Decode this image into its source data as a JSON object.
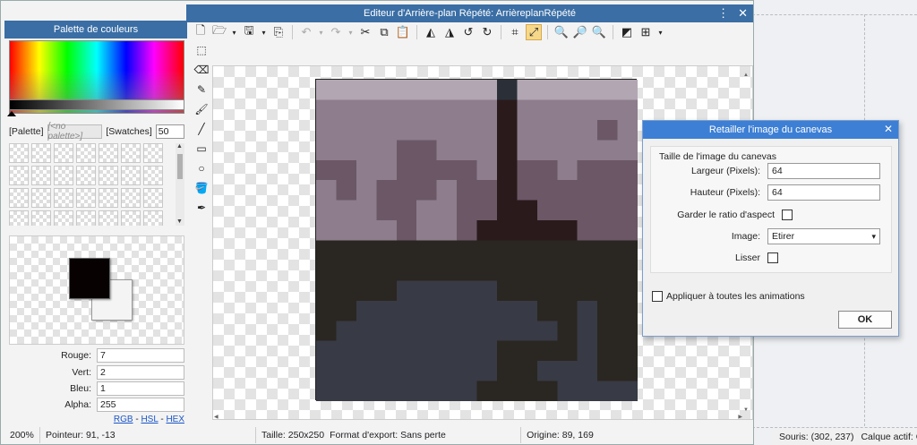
{
  "window": {
    "title": "Editeur d'Arrière-plan Répété: ArrièreplanRépété",
    "menu_icon": "⋮",
    "close_icon": "✕"
  },
  "palette": {
    "title": "Palette de couleurs",
    "palette_label": "[Palette]",
    "no_palette": "[<no palette>]",
    "swatches_label": "[Swatches]",
    "swatch_count": "50",
    "primary_color": "#070201",
    "secondary_color": "#f4f4f4"
  },
  "color": {
    "rows": [
      {
        "label": "Rouge:",
        "value": "7"
      },
      {
        "label": "Vert:",
        "value": "2"
      },
      {
        "label": "Bleu:",
        "value": "1"
      },
      {
        "label": "Alpha:",
        "value": "255"
      }
    ],
    "links": {
      "rgb": "RGB",
      "sep1": " - ",
      "hsl": "HSL",
      "sep2": " - ",
      "hex": "HEX"
    }
  },
  "status": {
    "zoom": "200%",
    "pointer": "Pointeur: 91, -13",
    "size": "Taille: 250x250",
    "export": "Format d'export: Sans perte",
    "origin": "Origine: 89, 169"
  },
  "background_status": {
    "mouse": "Souris: (302, 237)",
    "layer": "Calque actif: Cal"
  },
  "dialog": {
    "title": "Retailler l'image du canevas",
    "close_icon": "✕",
    "group_title": "Taille de l'image du canevas",
    "width_label": "Largeur (Pixels):",
    "width_value": "64",
    "height_label": "Hauteur (Pixels):",
    "height_value": "64",
    "aspect_label": "Garder le ratio d'aspect",
    "image_label": "Image:",
    "image_value": "Etirer",
    "smooth_label": "Lisser",
    "apply_all_label": "Appliquer à toutes les animations",
    "ok_label": "OK"
  },
  "icons": {
    "new": "🗋",
    "open": "🗁",
    "save": "🖫",
    "export": "⎘",
    "undo": "↶",
    "redo": "↷",
    "cut": "✂",
    "copy": "⧉",
    "paste": "📋",
    "flip_h": "◭",
    "flip_v": "◮",
    "rot_ccw": "↺",
    "rot_cw": "↻",
    "crop": "⌗",
    "resize": "⤢",
    "zoom_in": "🔍",
    "zoom_out": "🔎",
    "zoom_fit": "🔍",
    "bg": "◩",
    "grid": "⊞",
    "dropdown": "▾",
    "select": "⬚",
    "eraser": "⌫",
    "pencil": "✎",
    "brush": "🖌",
    "line": "╱",
    "rect": "▭",
    "ellipse": "○",
    "fill": "🪣",
    "picker": "✒",
    "scroll_up": "▲",
    "scroll_down": "▼",
    "scroll_left": "◀",
    "scroll_right": "▶"
  },
  "colors": {
    "accent": "#3a6ea5",
    "dialog_title": "#3d7fd4"
  }
}
